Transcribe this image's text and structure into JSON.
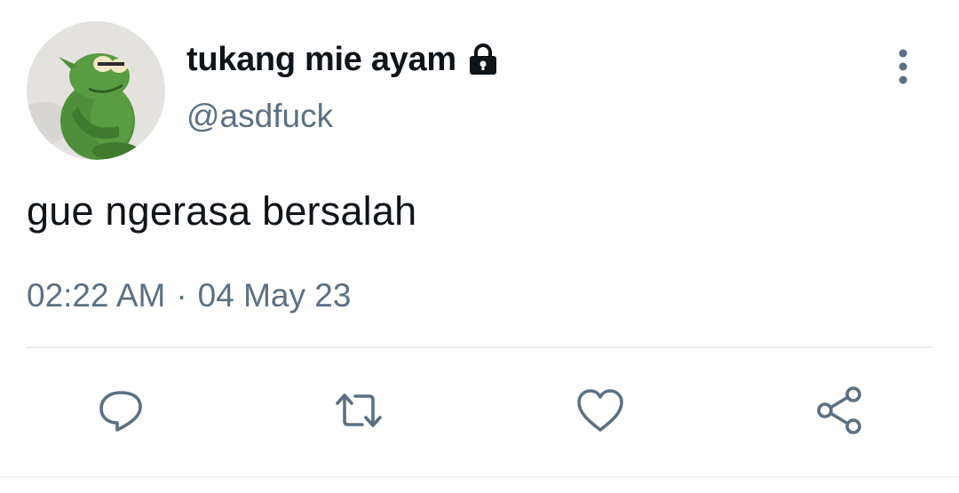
{
  "tweet": {
    "display_name": "tukang mie ayam",
    "handle": "@asdfuck",
    "text": "gue ngerasa bersalah",
    "time": "02:22 AM",
    "separator": "·",
    "date": "04 May 23",
    "protected": true
  },
  "icons": {
    "lock": "lock-icon",
    "more": "more-vertical-icon",
    "reply": "reply-icon",
    "retweet": "retweet-icon",
    "like": "heart-icon",
    "share": "share-icon"
  },
  "colors": {
    "text_primary": "#0f1419",
    "text_secondary": "#5b7083",
    "icon": "#5b7083",
    "divider": "#e6ecf0",
    "avatar_green": "#4f8f3a"
  }
}
